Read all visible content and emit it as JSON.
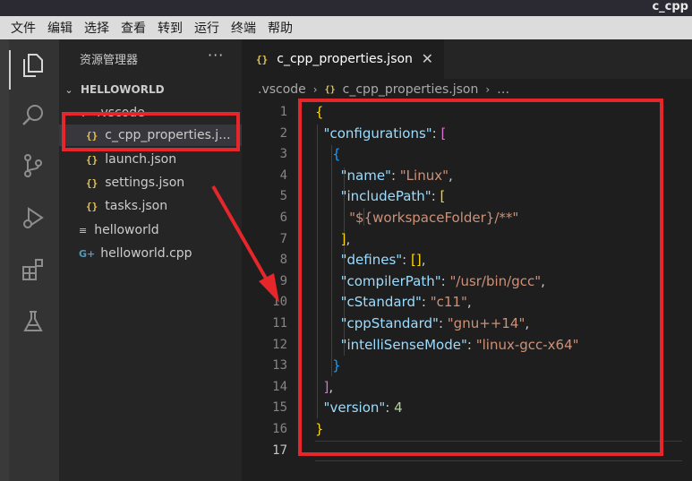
{
  "window": {
    "title": "c_cpp"
  },
  "menu": [
    "文件",
    "编辑",
    "选择",
    "查看",
    "转到",
    "运行",
    "终端",
    "帮助"
  ],
  "activity_icons": [
    "explorer-icon",
    "search-icon",
    "source-control-icon",
    "run-debug-icon",
    "extensions-icon",
    "testing-icon"
  ],
  "sidebar": {
    "title": "资源管理器",
    "more": "···",
    "root": "HELLOWORLD",
    "folder": ".vscode",
    "files": [
      "c_cpp_properties.j...",
      "launch.json",
      "settings.json",
      "tasks.json"
    ],
    "root_files": [
      "helloworld",
      "helloworld.cpp"
    ]
  },
  "tab": {
    "label": "c_cpp_properties.json",
    "close": "✕"
  },
  "breadcrumb": {
    "folder": ".vscode",
    "file": "c_cpp_properties.json",
    "more": "…"
  },
  "code": {
    "line_numbers": [
      "1",
      "2",
      "3",
      "4",
      "5",
      "6",
      "7",
      "8",
      "9",
      "10",
      "11",
      "12",
      "13",
      "14",
      "15",
      "16",
      "17"
    ],
    "keys": {
      "configurations": "\"configurations\"",
      "name": "\"name\"",
      "includePath": "\"includePath\"",
      "defines": "\"defines\"",
      "compilerPath": "\"compilerPath\"",
      "cStandard": "\"cStandard\"",
      "cppStandard": "\"cppStandard\"",
      "intelliSenseMode": "\"intelliSenseMode\"",
      "version": "\"version\""
    },
    "values": {
      "name": "\"Linux\"",
      "includePath": "\"${workspaceFolder}/**\"",
      "compilerPath": "\"/usr/bin/gcc\"",
      "cStandard": "\"c11\"",
      "cppStandard": "\"gnu++14\"",
      "intelliSenseMode": "\"linux-gcc-x64\"",
      "version": "4"
    }
  },
  "colors": {
    "annotation": "#e5262a",
    "key": "#9cdcfe",
    "string": "#ce9178",
    "number": "#b5cea8"
  }
}
